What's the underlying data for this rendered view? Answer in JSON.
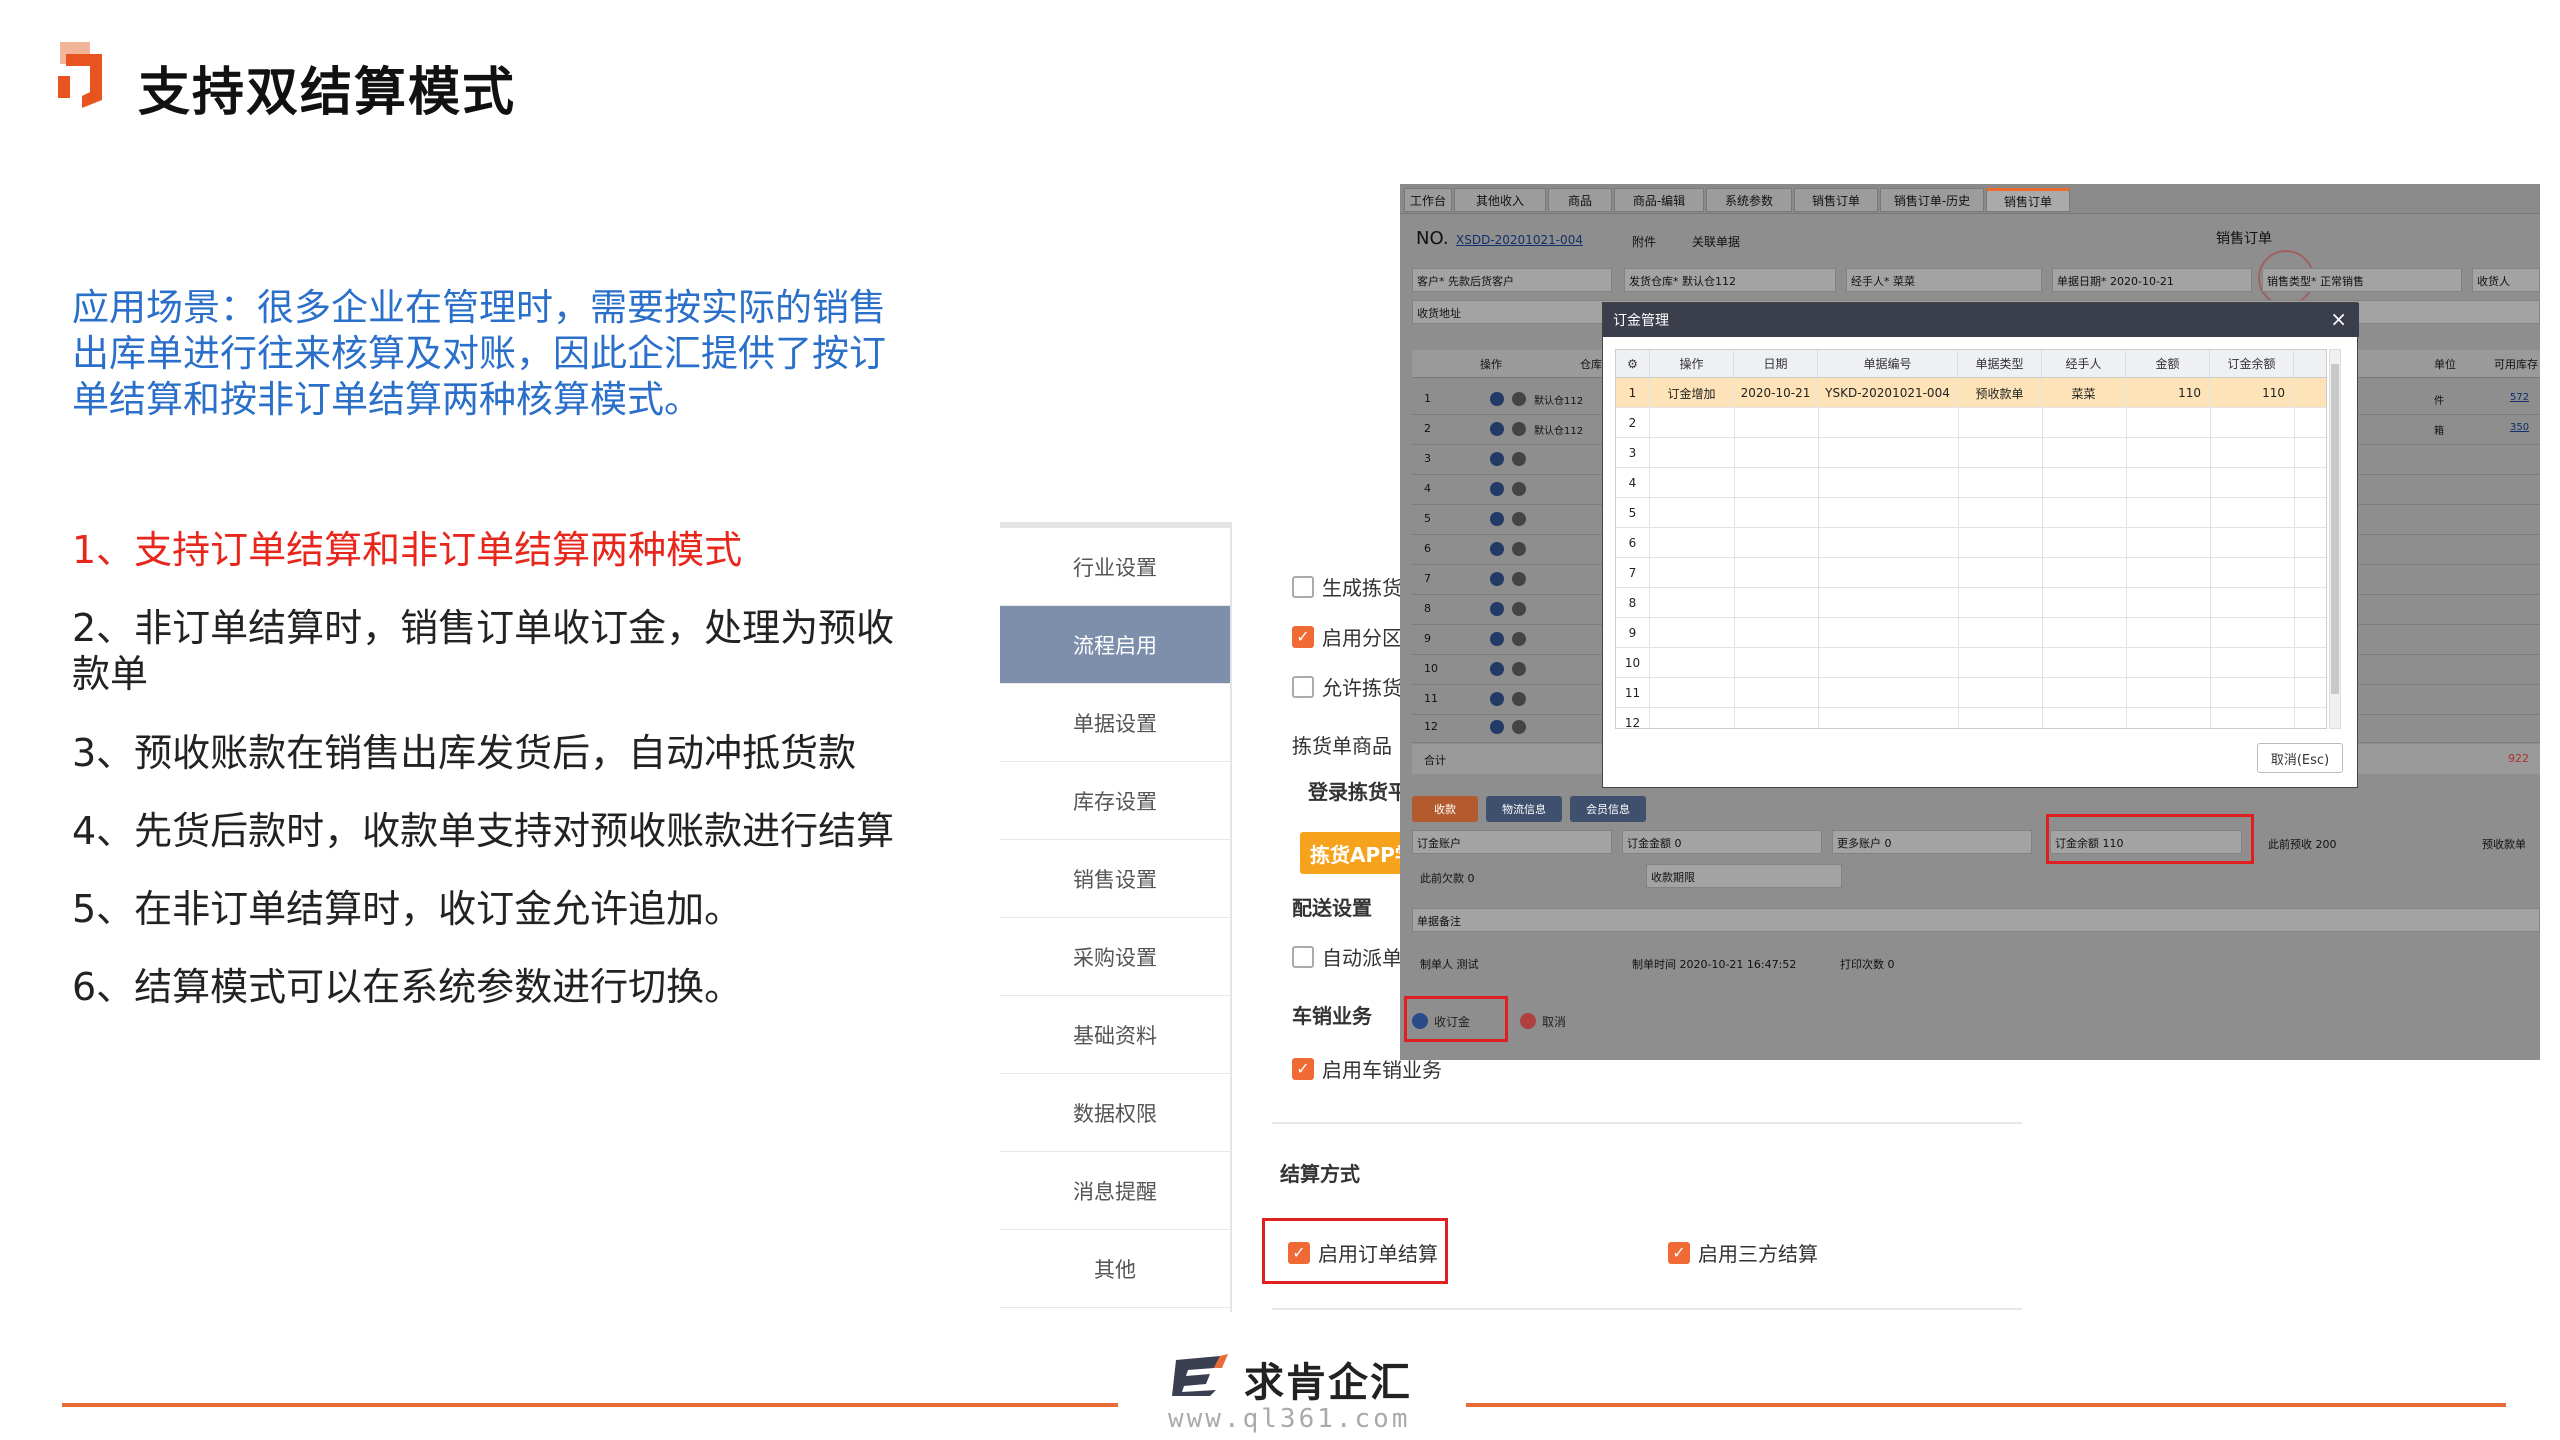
{
  "title": "支持双结算模式",
  "scenario": "应用场景：很多企业在管理时，需要按实际的销售出库单进行往来核算及对账，因此企汇提供了按订单结算和按非订单结算两种核算模式。",
  "features": [
    "1、支持订单结算和非订单结算两种模式",
    "2、非订单结算时，销售订单收订金，处理为预收款单",
    "3、预收账款在销售出库发货后，自动冲抵货款",
    "4、先货后款时，收款单支持对预收账款进行结算",
    "5、在非订单结算时，收订金允许追加。",
    "6、结算模式可以在系统参数进行切换。"
  ],
  "settings": {
    "sidebar": [
      "行业设置",
      "流程启用",
      "单据设置",
      "库存设置",
      "销售设置",
      "采购设置",
      "基础资料",
      "数据权限",
      "消息提醒",
      "其他"
    ],
    "active_index": 1,
    "checks": {
      "gen_pick": "生成拣货",
      "enable_zone": "启用分区",
      "allow_pick": "允许拣货",
      "auto_dispatch": "自动派单",
      "vehicle_sales": "启用车销业务",
      "order_settle": "启用订单结算",
      "third_party": "启用三方结算"
    },
    "headings": {
      "pick_goods": "拣货单商品",
      "login_pick": "登录拣货平",
      "delivery": "配送设置",
      "vehicle": "车销业务",
      "settlement": "结算方式"
    },
    "app_button": "拣货APP学"
  },
  "order": {
    "tabs": [
      "工作台",
      "其他收入",
      "商品",
      "商品-编辑",
      "系统参数",
      "销售订单",
      "销售订单-历史",
      "销售订单"
    ],
    "no_label": "NO.",
    "no_value": "XSDD-20201021-004",
    "attach": "附件",
    "link": "关联单据",
    "doc_title": "销售订单",
    "customer": "客户* 先款后货客户",
    "warehouse": "发货仓库* 默认仓112",
    "handler": "经手人* 菜菜",
    "date": "单据日期* 2020-10-21",
    "sales_type": "销售类型* 正常销售",
    "receiver": "收货人",
    "address": "收货地址",
    "grid_headers": [
      "操作",
      "仓库",
      "单位",
      "可用库存"
    ],
    "grid_rows": [
      {
        "n": "1",
        "wh": "默认仓112",
        "unit": "件",
        "stock": "572"
      },
      {
        "n": "2",
        "wh": "默认仓112",
        "unit": "箱",
        "stock": "350"
      }
    ],
    "row_numbers": [
      "3",
      "4",
      "5",
      "6",
      "7",
      "8",
      "9",
      "10",
      "11",
      "12"
    ],
    "total_label": "合计",
    "total_value": "922",
    "tab_buttons": [
      "收款",
      "物流信息",
      "会员信息"
    ],
    "deposit_account": "订金账户",
    "deposit_amount": "订金金额 0",
    "more_accounts": "更多账户 0",
    "deposit_balance": "订金余额 110",
    "this_prepay": "此前预收 200",
    "prepay_receipt": "预收款单",
    "this_owe": "此前欠款 0",
    "due_date": "收款期限",
    "remarks": "单据备注",
    "creator": "制单人 测试",
    "created_time": "制单时间 2020-10-21 16:47:52",
    "print_count": "打印次数 0",
    "btn_deposit": "收订金",
    "btn_cancel": "取消"
  },
  "dialog": {
    "title": "订金管理",
    "headers": [
      "操作",
      "日期",
      "单据编号",
      "单据类型",
      "经手人",
      "金额",
      "订金余额"
    ],
    "rows": [
      {
        "n": "1",
        "op": "订金增加",
        "date": "2020-10-21",
        "no": "YSKD-20201021-004",
        "type": "预收款单",
        "handler": "菜菜",
        "amount": "110",
        "balance": "110"
      }
    ],
    "empty_rows": [
      "2",
      "3",
      "4",
      "5",
      "6",
      "7",
      "8",
      "9",
      "10",
      "11",
      "12"
    ],
    "cancel": "取消(Esc)"
  },
  "footer": {
    "brand": "求肯企汇",
    "url": "www.ql361.com"
  },
  "colors": {
    "accent_orange": "#e86a35",
    "scenario_blue": "#2a6fc9",
    "highlight_red": "#e8271c",
    "sidebar_active": "#7d8fab"
  }
}
